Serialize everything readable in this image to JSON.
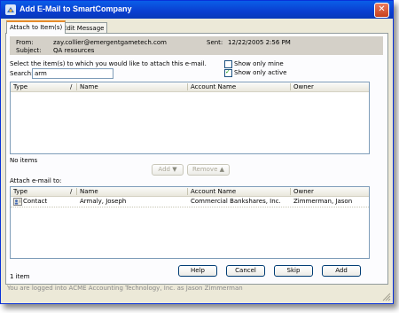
{
  "window": {
    "title": "Add E-Mail to SmartCompany"
  },
  "tabs": [
    {
      "label": "Attach to Item(s)"
    },
    {
      "label": "Edit Message"
    }
  ],
  "header": {
    "from_label": "From:",
    "from_value": "zay.collier@emergentgametech.com",
    "sent_label": "Sent:",
    "sent_value": "12/22/2005 2:56 PM",
    "subject_label": "Subject:",
    "subject_value": "QA resources"
  },
  "search": {
    "instruction": "Select the item(s) to which you would like to attach this e-mail.",
    "label": "Search:",
    "value": "arm"
  },
  "filters": {
    "show_only_mine": {
      "label": "Show only mine",
      "checked": false
    },
    "show_only_active": {
      "label": "Show only active",
      "checked": true
    }
  },
  "results_grid": {
    "columns": [
      "Type",
      "/",
      "Name",
      "Account Name",
      "Owner"
    ],
    "rows": [],
    "status": "No items"
  },
  "move_buttons": {
    "add": "Add",
    "remove": "Remove"
  },
  "attach": {
    "label": "Attach e-mail to:",
    "columns": [
      "Type",
      "/",
      "Name",
      "Account Name",
      "Owner"
    ],
    "rows": [
      {
        "type": "Contact",
        "name": "Armaly, Joseph",
        "account": "Commercial Bankshares, Inc.",
        "owner": "Zimmerman, Jason"
      }
    ],
    "count": "1 item"
  },
  "actions": {
    "help": "Help",
    "cancel": "Cancel",
    "skip": "Skip",
    "add": "Add"
  },
  "status_bar": "You are logged into ACME Accounting Technology, Inc. as Jason Zimmerman"
}
